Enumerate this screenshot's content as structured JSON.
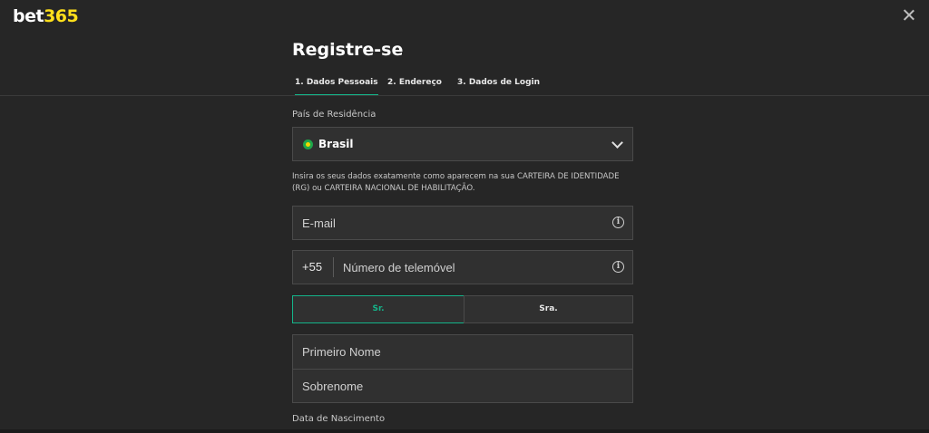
{
  "brand": {
    "logo_primary": "bet",
    "logo_accent": "365",
    "accent_color": "#ffdf1b",
    "highlight_color": "#14b58a"
  },
  "header": {
    "title": "Registre-se",
    "close_icon": "close-icon"
  },
  "tabs": [
    {
      "label": "1. Dados Pessoais",
      "active": true
    },
    {
      "label": "2. Endereço",
      "active": false
    },
    {
      "label": "3. Dados de Login",
      "active": false
    }
  ],
  "form": {
    "country_label": "País de Residência",
    "country_value": "Brasil",
    "country_flag_icon": "brazil-flag-icon",
    "info_text": "Insira os seus dados exatamente como aparecem na sua CARTEIRA DE IDENTIDADE (RG) ou CARTEIRA NACIONAL DE HABILITAÇÃO.",
    "email_placeholder": "E-mail",
    "phone_prefix": "+55",
    "phone_placeholder": "Número de telemóvel",
    "gender_options": [
      {
        "label": "Sr.",
        "selected": true
      },
      {
        "label": "Sra.",
        "selected": false
      }
    ],
    "first_name_placeholder": "Primeiro Nome",
    "last_name_placeholder": "Sobrenome",
    "birthdate_label": "Data de Nascimento"
  }
}
